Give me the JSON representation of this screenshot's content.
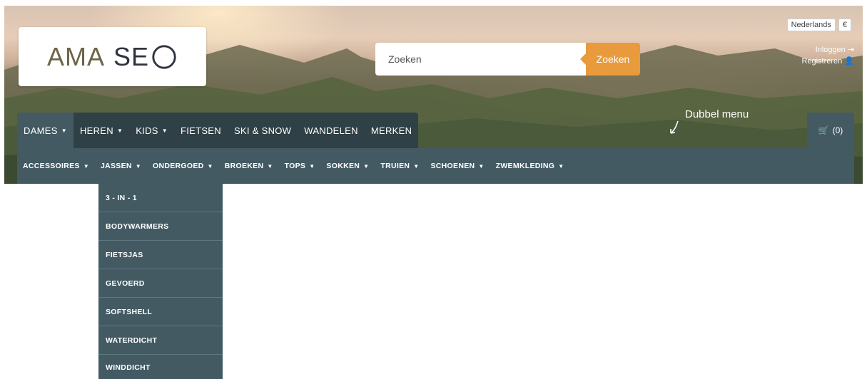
{
  "header": {
    "language": "Nederlands",
    "currency": "€",
    "logo": {
      "part1": "AMA",
      "part2": "SE"
    },
    "search": {
      "placeholder": "Zoeken",
      "button": "Zoeken"
    },
    "account": {
      "login": "Inloggen",
      "register": "Registreren"
    },
    "annotation": "Dubbel menu"
  },
  "mainnav": {
    "items": [
      {
        "label": "DAMES",
        "dropdown": true
      },
      {
        "label": "HEREN",
        "dropdown": true
      },
      {
        "label": "KIDS",
        "dropdown": true
      },
      {
        "label": "FIETSEN",
        "dropdown": false
      },
      {
        "label": "SKI & SNOW",
        "dropdown": false
      },
      {
        "label": "WANDELEN",
        "dropdown": false
      },
      {
        "label": "MERKEN",
        "dropdown": false
      }
    ],
    "cart": "(0)"
  },
  "subnav": {
    "items": [
      "ACCESSOIRES",
      "JASSEN",
      "ONDERGOED",
      "BROEKEN",
      "TOPS",
      "SOKKEN",
      "TRUIEN",
      "SCHOENEN",
      "ZWEMKLEDING"
    ]
  },
  "dropdown": {
    "items": [
      "3 - IN - 1",
      "BODYWARMERS",
      "FIETSJAS",
      "GEVOERD",
      "SOFTSHELL",
      "WATERDICHT",
      "WINDDICHT"
    ]
  },
  "colors": {
    "accent": "#e89a3c",
    "nav_dark": "#2f4046",
    "nav_light": "#435a63"
  },
  "icons": {
    "login": "sign-in-icon",
    "register": "user-plus-icon",
    "cart": "cart-icon",
    "logo_mark": "compass-icon",
    "caret": "caret-down-icon"
  }
}
